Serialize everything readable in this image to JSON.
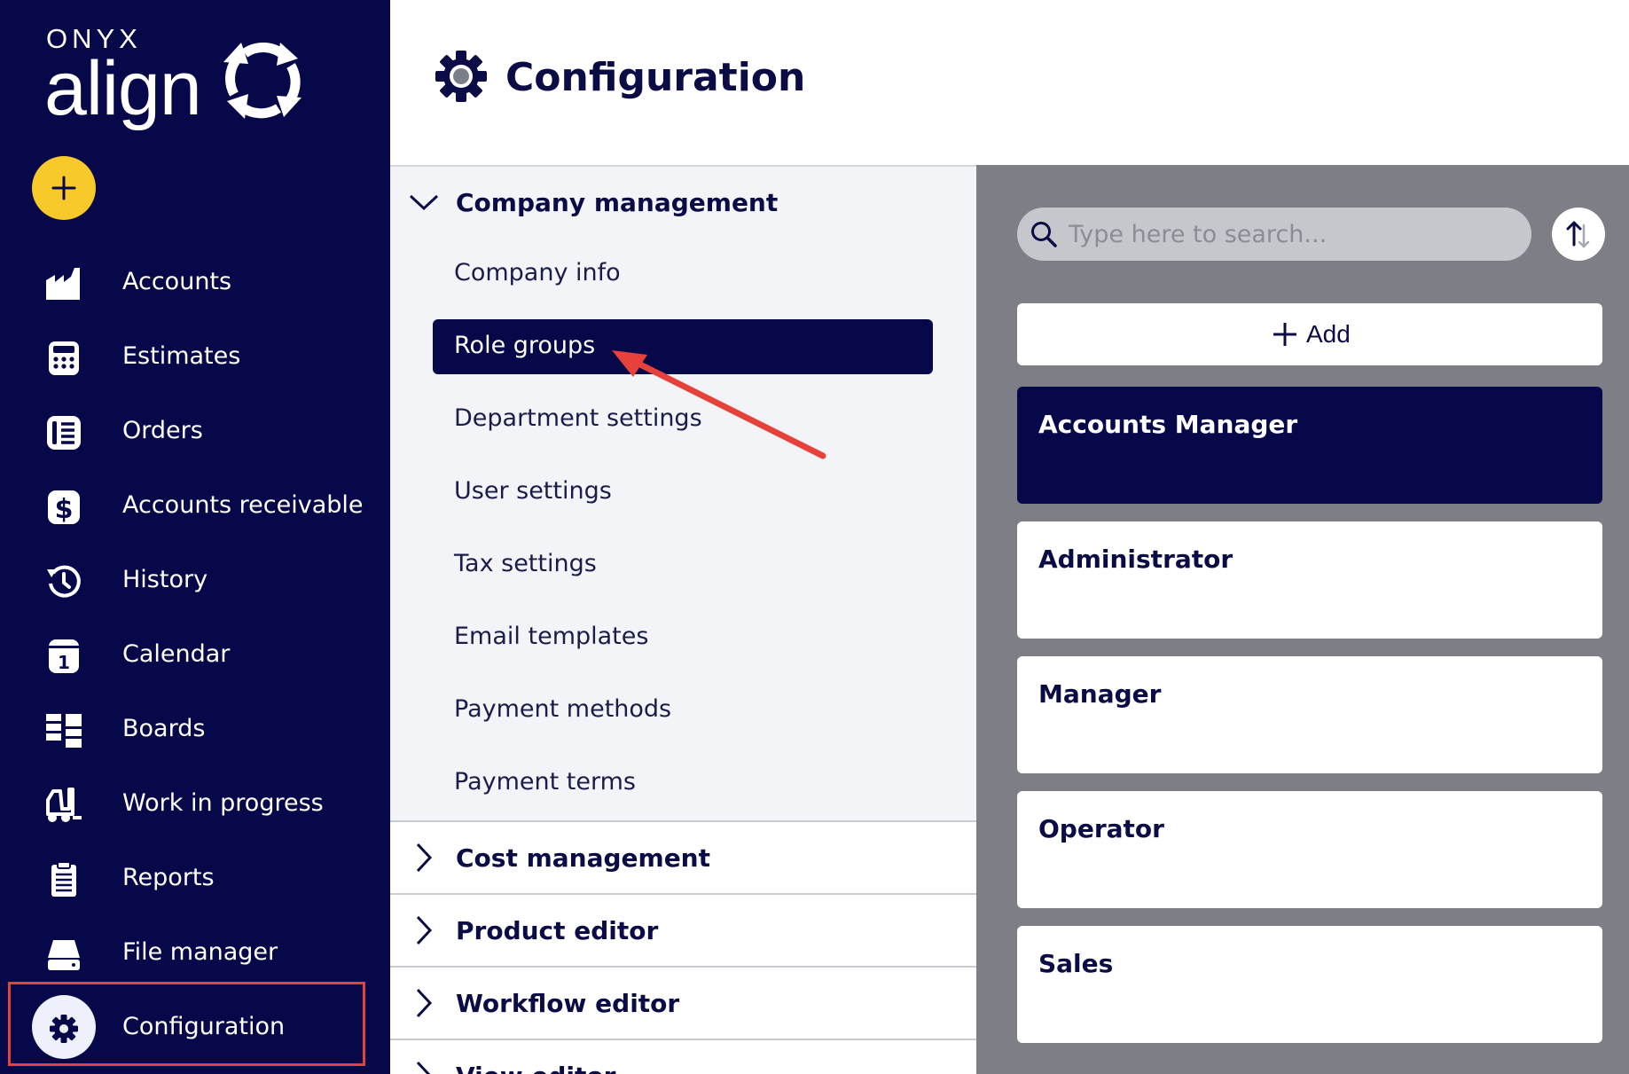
{
  "brand": {
    "top": "ONYX",
    "bottom": "align"
  },
  "colors": {
    "sidebar": "#07084a",
    "accent": "#f8c92a",
    "selected": "#07084a",
    "panel": "#7e7e86",
    "annotation": "#e8403b"
  },
  "sidebar": {
    "create_icon": "plus-icon",
    "items": [
      {
        "label": "Accounts",
        "icon": "factory-icon"
      },
      {
        "label": "Estimates",
        "icon": "calculator-icon"
      },
      {
        "label": "Orders",
        "icon": "orders-icon"
      },
      {
        "label": "Accounts receivable",
        "icon": "dollar-icon"
      },
      {
        "label": "History",
        "icon": "history-icon"
      },
      {
        "label": "Calendar",
        "icon": "calendar-icon"
      },
      {
        "label": "Boards",
        "icon": "boards-icon"
      },
      {
        "label": "Work in progress",
        "icon": "forklift-icon"
      },
      {
        "label": "Reports",
        "icon": "clipboard-icon"
      },
      {
        "label": "File manager",
        "icon": "drive-icon"
      },
      {
        "label": "Configuration",
        "icon": "gear-icon",
        "active": true
      }
    ]
  },
  "header": {
    "title": "Configuration",
    "icon": "gear-icon"
  },
  "settings_menu": {
    "expanded_section": {
      "label": "Company management",
      "items": [
        {
          "label": "Company info"
        },
        {
          "label": "Role groups",
          "selected": true
        },
        {
          "label": "Department settings"
        },
        {
          "label": "User settings"
        },
        {
          "label": "Tax settings"
        },
        {
          "label": "Email templates"
        },
        {
          "label": "Payment methods"
        },
        {
          "label": "Payment terms"
        }
      ]
    },
    "collapsed_sections": [
      {
        "label": "Cost management"
      },
      {
        "label": "Product editor"
      },
      {
        "label": "Workflow editor"
      },
      {
        "label": "View editor"
      }
    ]
  },
  "list_panel": {
    "search": {
      "placeholder": "Type here to search...",
      "value": ""
    },
    "sort_icon": "sort-arrows-icon",
    "add_label": "Add",
    "roles": [
      {
        "name": "Accounts Manager",
        "selected": true
      },
      {
        "name": "Administrator"
      },
      {
        "name": "Manager"
      },
      {
        "name": "Operator"
      },
      {
        "name": "Sales"
      }
    ]
  }
}
